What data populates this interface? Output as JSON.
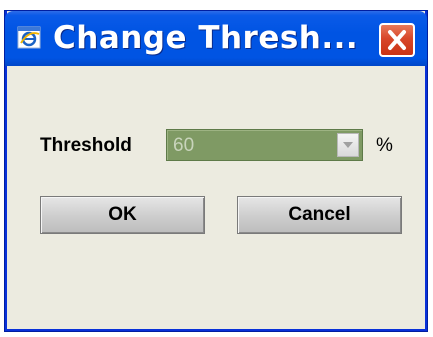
{
  "window": {
    "title": "Change Thresh..."
  },
  "form": {
    "threshold_label": "Threshold",
    "threshold_value": "60",
    "unit": "%"
  },
  "buttons": {
    "ok_label": "OK",
    "cancel_label": "Cancel"
  },
  "icons": {
    "app": "ie-window-icon",
    "close": "close-icon",
    "dropdown": "chevron-down-icon"
  },
  "colors": {
    "titlebar": "#0054e3",
    "close_button": "#d8472a",
    "dialog_background": "#ecebe0",
    "combo_disabled": "#7f9a64"
  }
}
